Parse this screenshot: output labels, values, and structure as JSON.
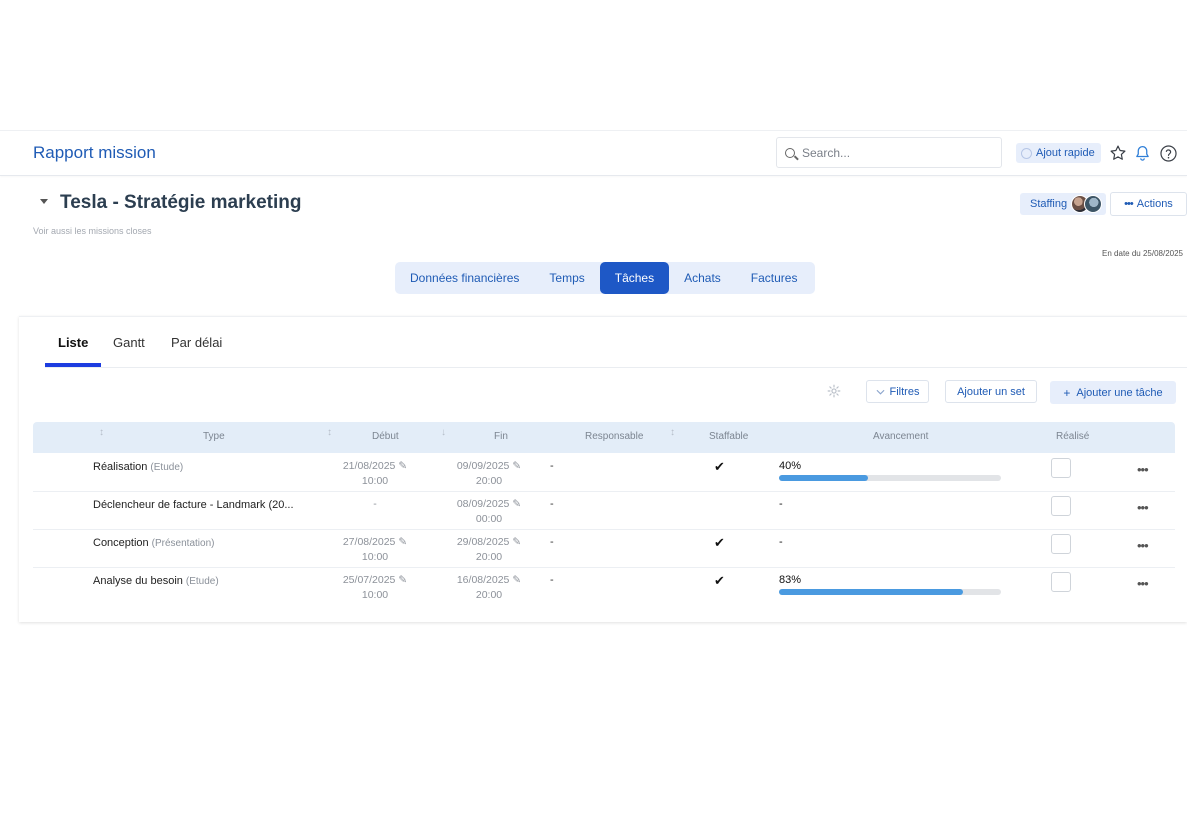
{
  "header": {
    "title": "Rapport mission",
    "search_placeholder": "Search...",
    "quick_add": "Ajout rapide"
  },
  "mission": {
    "title": "Tesla - Stratégie marketing",
    "subtitle": "Voir aussi les missions closes",
    "staffing": "Staffing",
    "actions": "Actions",
    "as_of": "En date du 25/08/2025"
  },
  "main_tabs": [
    {
      "label": "Données financières"
    },
    {
      "label": "Temps"
    },
    {
      "label": "Tâches"
    },
    {
      "label": "Achats"
    },
    {
      "label": "Factures"
    }
  ],
  "main_tabs_active": "Tâches",
  "sub_tabs": [
    {
      "label": "Liste"
    },
    {
      "label": "Gantt"
    },
    {
      "label": "Par délai"
    }
  ],
  "toolbar": {
    "filters": "Filtres",
    "add_set": "Ajouter un set",
    "add_task": "Ajouter une tâche"
  },
  "table": {
    "columns": {
      "type": "Type",
      "start": "Début",
      "end": "Fin",
      "owner": "Responsable",
      "staffable": "Staffable",
      "progress": "Avancement",
      "done": "Réalisé"
    },
    "rows": [
      {
        "name": "Réalisation",
        "type": "(Etude)",
        "start_date": "21/08/2025",
        "start_time": "10:00",
        "end_date": "09/09/2025",
        "end_time": "20:00",
        "owner": "-",
        "staffable": "✔",
        "progress_label": "40%",
        "progress": 0.4
      },
      {
        "name": "Déclencheur de facture - Landmark (20...",
        "type": "",
        "start_date": "-",
        "start_time": "",
        "end_date": "08/09/2025",
        "end_time": "00:00",
        "owner": "-",
        "staffable": "",
        "progress_label": "-",
        "progress": null
      },
      {
        "name": "Conception",
        "type": "(Présentation)",
        "start_date": "27/08/2025",
        "start_time": "10:00",
        "end_date": "29/08/2025",
        "end_time": "20:00",
        "owner": "-",
        "staffable": "✔",
        "progress_label": "-",
        "progress": null
      },
      {
        "name": "Analyse du besoin",
        "type": "(Etude)",
        "start_date": "25/07/2025",
        "start_time": "10:00",
        "end_date": "16/08/2025",
        "end_time": "20:00",
        "owner": "-",
        "staffable": "✔",
        "progress_label": "83%",
        "progress": 0.83
      }
    ]
  },
  "colors": {
    "primary": "#1e58c6",
    "link": "#1f5bb5",
    "soft_bg": "#e7eefb",
    "progress_fill": "#4a9ae0",
    "underline": "#1c3ce0"
  }
}
